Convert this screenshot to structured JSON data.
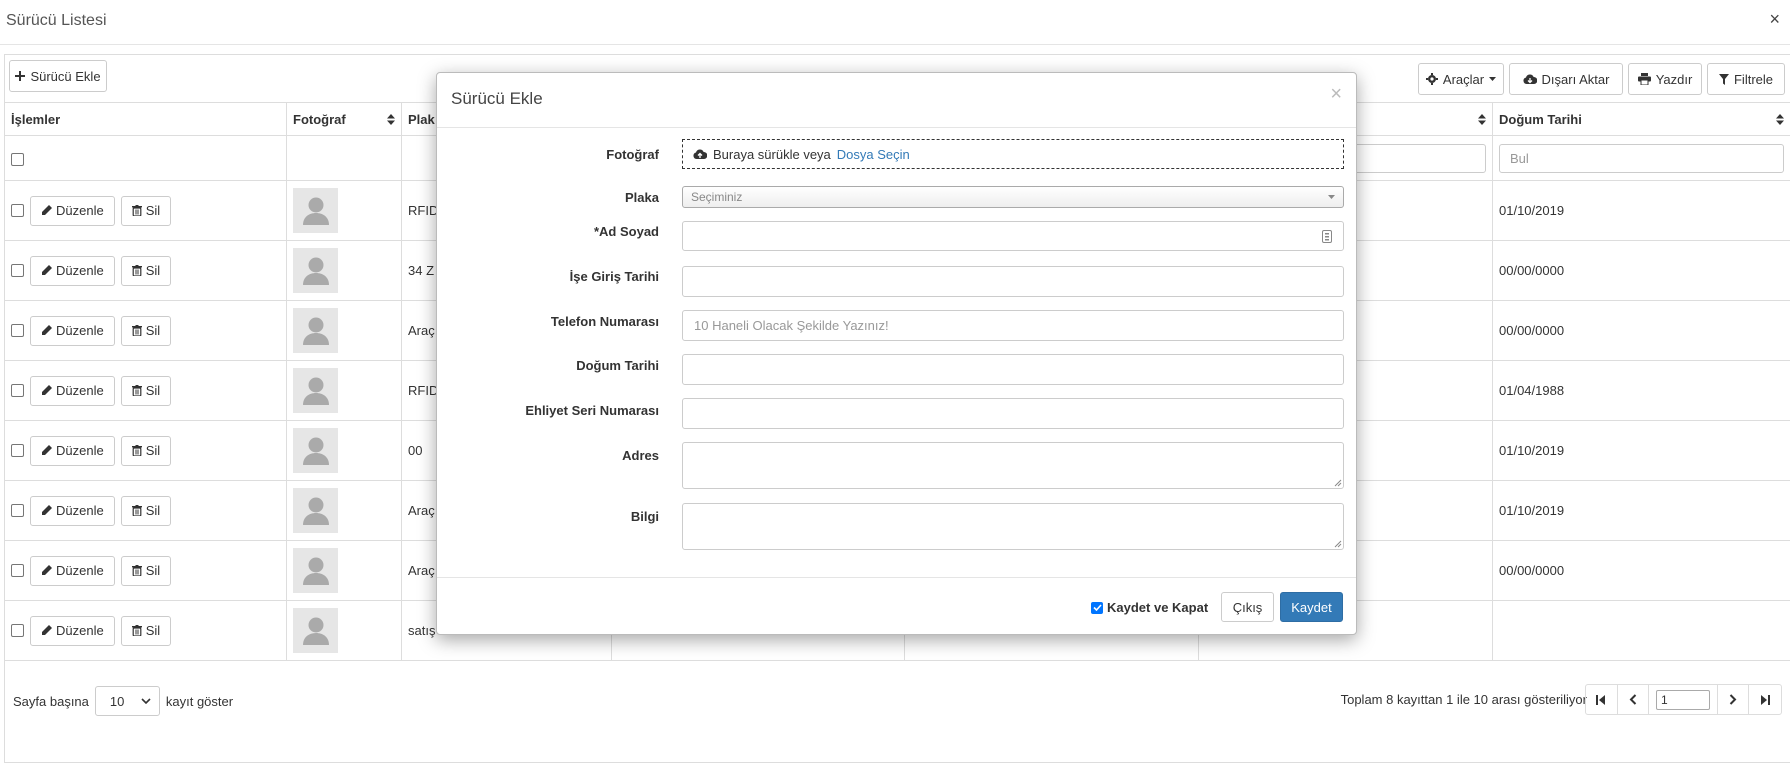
{
  "page": {
    "title": "Sürücü Listesi",
    "close": "×"
  },
  "toolbar": {
    "add_label": "Sürücü Ekle",
    "tools_label": "Araçlar",
    "export_label": "Dışarı Aktar",
    "print_label": "Yazdır",
    "filter_label": "Filtrele"
  },
  "table": {
    "headers": {
      "actions": "İşlemler",
      "photo": "Fotoğraf",
      "plate": "Plak",
      "birth_date": "Doğum Tarihi"
    },
    "filter_placeholder": "Bul",
    "edit_label": "Düzenle",
    "delete_label": "Sil",
    "rows": [
      {
        "plate": "RFID",
        "birth_date": "01/10/2019"
      },
      {
        "plate": "34 Z",
        "birth_date": "00/00/0000"
      },
      {
        "plate": "Araç",
        "birth_date": "00/00/0000"
      },
      {
        "plate": "RFID",
        "birth_date": "01/04/1988"
      },
      {
        "plate": "00",
        "birth_date": "01/10/2019"
      },
      {
        "plate": "Araç",
        "birth_date": "01/10/2019"
      },
      {
        "plate": "Araç",
        "birth_date": "00/00/0000"
      },
      {
        "plate": "satış",
        "birth_date": ""
      }
    ]
  },
  "footer": {
    "per_page_prefix": "Sayfa başına",
    "per_page_value": "10",
    "per_page_suffix": "kayıt göster",
    "info": "Toplam 8 kayıttan 1 ile 10 arası gösteriliyor",
    "page_value": "1"
  },
  "modal": {
    "title": "Sürücü Ekle",
    "close": "×",
    "photo_label": "Fotoğraf",
    "dropzone_text": "Buraya sürükle veya",
    "dropzone_link": "Dosya Seçin",
    "plate_label": "Plaka",
    "plate_placeholder": "Seçiminiz",
    "name_label": "*Ad Soyad",
    "start_date_label": "İşe Giriş Tarihi",
    "phone_label": "Telefon Numarası",
    "phone_placeholder": "10 Haneli Olacak Şekilde Yazınız!",
    "birth_label": "Doğum Tarihi",
    "license_label": "Ehliyet Seri Numarası",
    "address_label": "Adres",
    "info_label": "Bilgi",
    "save_close_label": "Kaydet ve Kapat",
    "exit_label": "Çıkış",
    "save_label": "Kaydet"
  },
  "colors": {
    "primary": "#337ab7",
    "checkbox": "#0075ff"
  }
}
